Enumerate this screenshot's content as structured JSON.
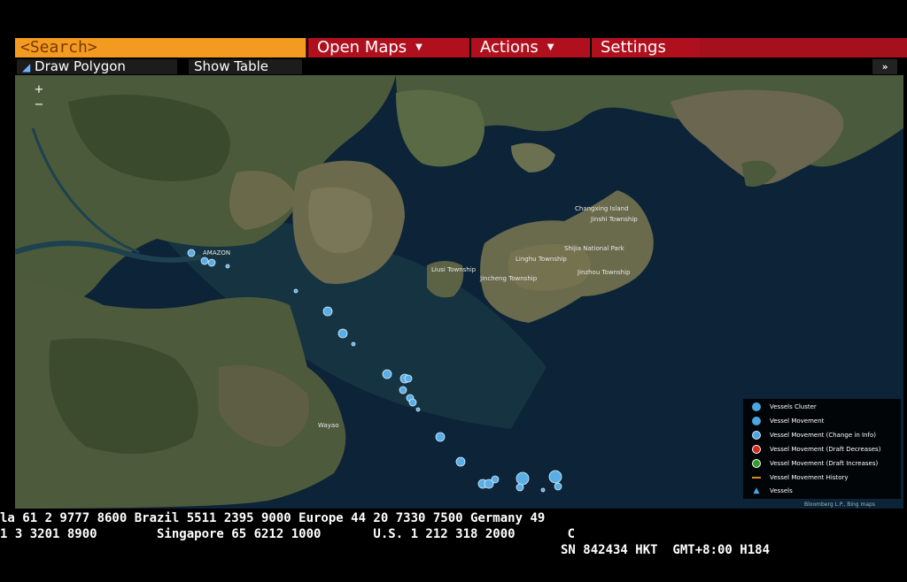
{
  "toolbar": {
    "search_placeholder": "<Search>",
    "open_maps": "Open Maps",
    "actions": "Actions",
    "settings": "Settings"
  },
  "subtoolbar": {
    "draw_polygon": "Draw Polygon",
    "show_table": "Show Table",
    "expand": "»"
  },
  "map": {
    "zoom_in": "+",
    "zoom_out": "−",
    "labels": [
      "AMAZON",
      "Changxing Island",
      "Jinshi Township",
      "Shijia National Park",
      "Linghu Township",
      "Jincheng Township",
      "Liusi Township",
      "Jinzhou Township",
      "Wayao"
    ],
    "attribution": "Bloomberg L.P., Bing maps"
  },
  "legend": {
    "items": [
      {
        "label": "Vessels Cluster",
        "color": "#4da6e0"
      },
      {
        "label": "Vessel Movement",
        "color": "#4da6e0"
      },
      {
        "label": "Vessel Movement (Change in Info)",
        "color": "#4da6e0"
      },
      {
        "label": "Vessel Movement (Draft Decreases)",
        "color": "#d9281e"
      },
      {
        "label": "Vessel Movement (Draft Increases)",
        "color": "#2aa02a"
      },
      {
        "label": "Vessel Movement History",
        "color": "#e08a1e"
      },
      {
        "label": "Vessels",
        "color": "#4da6e0"
      }
    ]
  },
  "ticker": {
    "line1": "la 61 2 9777 8600 Brazil 5511 2395 9000 Europe 44 20 7330 7500 Germany 49",
    "line2": "1 3 3201 8900        Singapore 65 6212 1000       U.S. 1 212 318 2000       C",
    "status": "SN 842434 HKT  GMT+8:00 H184"
  },
  "colors": {
    "search_bg": "#f39a21",
    "toolbar_red": "#a4101c",
    "water": "#0b2236",
    "vessel": "#4da6e0"
  }
}
